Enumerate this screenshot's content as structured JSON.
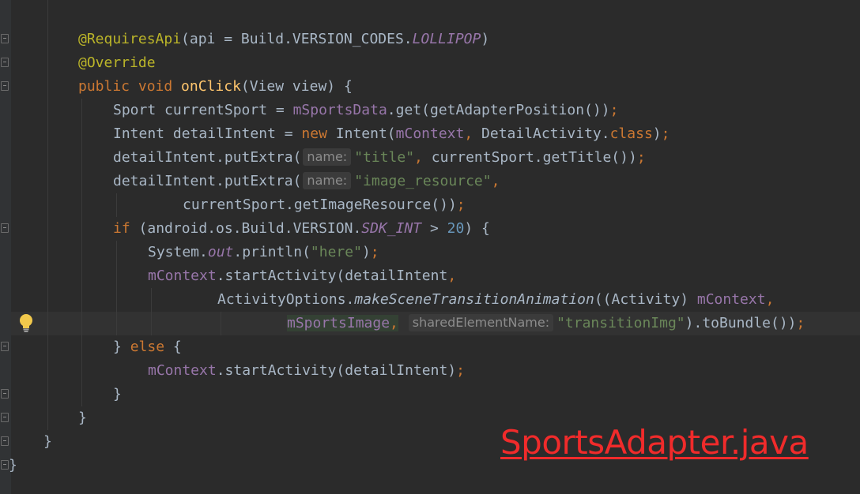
{
  "editor": {
    "file_label": "SportsAdapter.java",
    "lines": [
      {
        "tokens": [
          {
            "t": "@RequiresApi",
            "c": "ann"
          },
          {
            "t": "(api = Build.VERSION_CODES."
          },
          {
            "t": "LOLLIPOP",
            "c": "static"
          },
          {
            "t": ")"
          }
        ]
      },
      {
        "tokens": [
          {
            "t": "@Override",
            "c": "ann"
          }
        ]
      },
      {
        "tokens": [
          {
            "t": "public ",
            "c": "kw"
          },
          {
            "t": "void ",
            "c": "kw"
          },
          {
            "t": "onClick",
            "c": "fn"
          },
          {
            "t": "(View view) {"
          }
        ]
      },
      {
        "tokens": [
          {
            "t": "Sport currentSport = "
          },
          {
            "t": "mSportsData",
            "c": "field"
          },
          {
            "t": ".get(getAdapterPosition())"
          },
          {
            "t": ";",
            "c": "kw"
          }
        ]
      },
      {
        "tokens": [
          {
            "t": "Intent detailIntent = "
          },
          {
            "t": "new ",
            "c": "kw"
          },
          {
            "t": "Intent("
          },
          {
            "t": "mContext",
            "c": "field"
          },
          {
            "t": ", ",
            "c": "kw"
          },
          {
            "t": "DetailActivity."
          },
          {
            "t": "class",
            "c": "kw"
          },
          {
            "t": ")"
          },
          {
            "t": ";",
            "c": "kw"
          }
        ]
      },
      {
        "tokens": [
          {
            "t": "detailIntent.putExtra("
          },
          {
            "t": "name:",
            "c": "hint"
          },
          {
            "t": "\"title\"",
            "c": "str"
          },
          {
            "t": ", ",
            "c": "kw"
          },
          {
            "t": "currentSport.getTitle())"
          },
          {
            "t": ";",
            "c": "kw"
          }
        ]
      },
      {
        "tokens": [
          {
            "t": "detailIntent.putExtra("
          },
          {
            "t": "name:",
            "c": "hint"
          },
          {
            "t": "\"image_resource\"",
            "c": "str"
          },
          {
            "t": ",",
            "c": "kw"
          }
        ]
      },
      {
        "tokens": [
          {
            "t": "currentSport.getImageResource())"
          },
          {
            "t": ";",
            "c": "kw"
          }
        ]
      },
      {
        "tokens": [
          {
            "t": "if ",
            "c": "kw"
          },
          {
            "t": "(android.os.Build.VERSION."
          },
          {
            "t": "SDK_INT",
            "c": "static"
          },
          {
            "t": " > "
          },
          {
            "t": "20",
            "c": "num"
          },
          {
            "t": ") {"
          }
        ]
      },
      {
        "tokens": [
          {
            "t": "System."
          },
          {
            "t": "out",
            "c": "static"
          },
          {
            "t": ".println("
          },
          {
            "t": "\"here\"",
            "c": "str"
          },
          {
            "t": ")"
          },
          {
            "t": ";",
            "c": "kw"
          }
        ]
      },
      {
        "tokens": [
          {
            "t": "mContext",
            "c": "field"
          },
          {
            "t": ".startActivity(detailIntent"
          },
          {
            "t": ",",
            "c": "kw"
          }
        ]
      },
      {
        "tokens": [
          {
            "t": "ActivityOptions."
          },
          {
            "t": "makeSceneTransitionAnimation",
            "c": "italic"
          },
          {
            "t": "((Activity) "
          },
          {
            "t": "mContext",
            "c": "field"
          },
          {
            "t": ",",
            "c": "kw"
          }
        ]
      },
      {
        "tokens": [
          {
            "t": "mSportsImage",
            "c": "field hl"
          },
          {
            "t": ",",
            "c": "kw hl"
          },
          {
            "t": " "
          },
          {
            "t": "sharedElementName:",
            "c": "hint"
          },
          {
            "t": "\"transitionImg\"",
            "c": "str"
          },
          {
            "t": ").toBundle())"
          },
          {
            "t": ";",
            "c": "kw"
          }
        ]
      },
      {
        "tokens": [
          {
            "t": "} "
          },
          {
            "t": "else ",
            "c": "kw"
          },
          {
            "t": "{"
          }
        ]
      },
      {
        "tokens": [
          {
            "t": "mContext",
            "c": "field"
          },
          {
            "t": ".startActivity(detailIntent)"
          },
          {
            "t": ";",
            "c": "kw"
          }
        ]
      },
      {
        "tokens": [
          {
            "t": "}"
          }
        ]
      },
      {
        "tokens": [
          {
            "t": "}"
          }
        ]
      },
      {
        "tokens": [
          {
            "t": "}"
          }
        ]
      },
      {
        "tokens": [
          {
            "t": "}"
          }
        ]
      }
    ]
  },
  "colors": {
    "background": "#2b2b2b",
    "keyword": "#cc7832",
    "annotation": "#bbb529",
    "method": "#ffc66d",
    "string": "#6a8759",
    "number": "#6897bb",
    "field": "#9876aa",
    "watermark": "#f02b2b"
  },
  "icons": [
    "lightbulb-icon",
    "fold-marker-icon"
  ]
}
